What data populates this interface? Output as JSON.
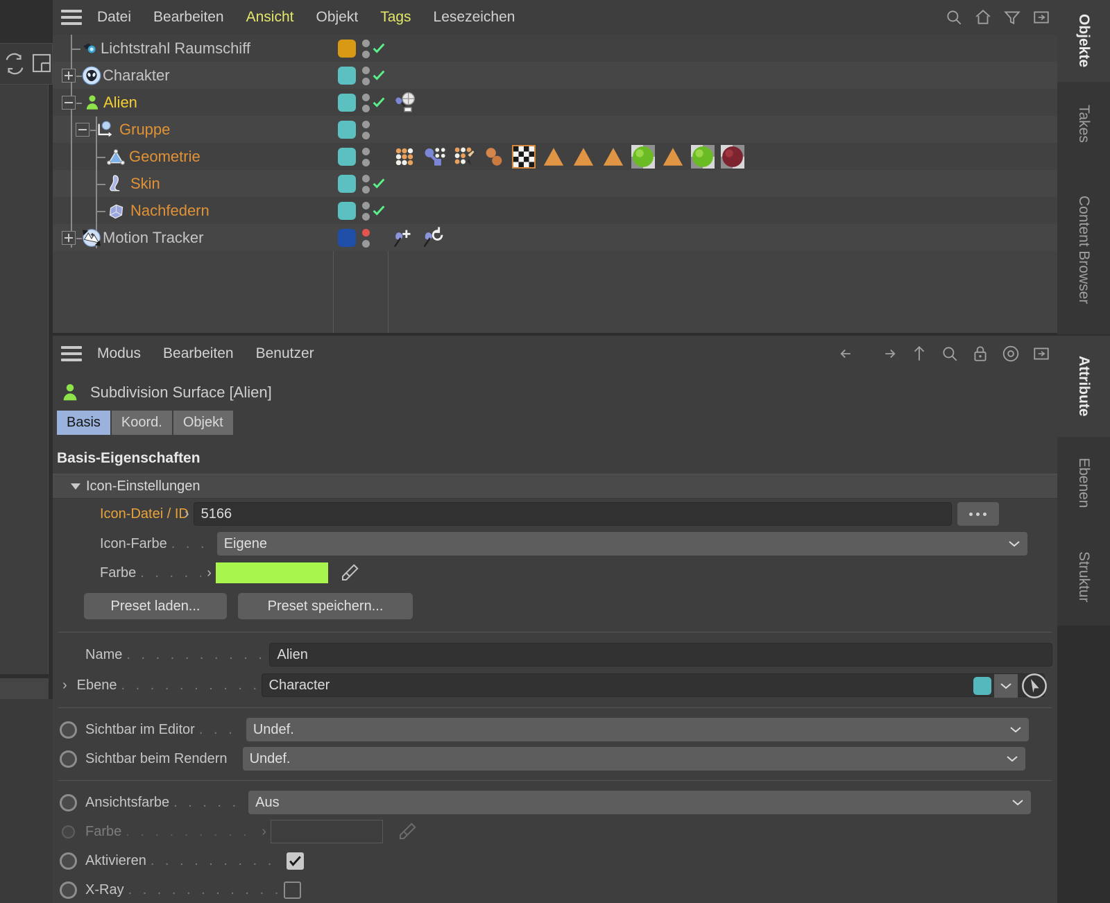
{
  "object_manager": {
    "menu": [
      {
        "label": "Datei",
        "highlight": false
      },
      {
        "label": "Bearbeiten",
        "highlight": false
      },
      {
        "label": "Ansicht",
        "highlight": true
      },
      {
        "label": "Objekt",
        "highlight": false
      },
      {
        "label": "Tags",
        "highlight": true
      },
      {
        "label": "Lesezeichen",
        "highlight": false
      }
    ],
    "toolbar_icons": [
      "search-icon",
      "home-icon",
      "filter-icon",
      "expand-panel-icon"
    ],
    "rows": [
      {
        "label": "Lichtstrahl Raumschiff",
        "color": "grey",
        "swatch": "#d89a15",
        "check": true,
        "dot_red": false,
        "indent": 1,
        "icon": "light-icon",
        "expander": "none",
        "tags": []
      },
      {
        "label": "Charakter",
        "color": "grey",
        "swatch": "#5cbfc0",
        "check": true,
        "dot_red": false,
        "indent": 0,
        "icon": "alien-head-icon",
        "expander": "plus",
        "tags": []
      },
      {
        "label": "Alien",
        "color": "yellow",
        "swatch": "#5cbfc0",
        "check": true,
        "dot_red": false,
        "indent": 0,
        "icon": "character-icon",
        "expander": "minus",
        "tags": [
          "joint-constraint-tag"
        ]
      },
      {
        "label": "Gruppe",
        "color": "orange",
        "swatch": "#5cbfc0",
        "check": false,
        "dot_red": false,
        "indent": 1,
        "icon": "null-object-icon",
        "expander": "minus",
        "tags": []
      },
      {
        "label": "Geometrie",
        "color": "orange",
        "swatch": "#5cbfc0",
        "check": false,
        "dot_red": false,
        "indent": 2,
        "icon": "polygon-icon",
        "expander": "none",
        "tags": [
          "point-cluster-tag",
          "weight-tag",
          "texture-brush-tag",
          "sphere-pair-tag",
          "checker-texture-tag",
          "cone-tag",
          "cone-tag",
          "cone-tag",
          "green-sphere-tag",
          "cone-tag",
          "green-sphere-tag",
          "red-sphere-tag"
        ]
      },
      {
        "label": "Skin",
        "color": "orange",
        "swatch": "#5cbfc0",
        "check": true,
        "dot_red": false,
        "indent": 2,
        "icon": "skin-icon",
        "expander": "none",
        "tags": []
      },
      {
        "label": "Nachfedern",
        "color": "orange",
        "swatch": "#5cbfc0",
        "check": true,
        "dot_red": false,
        "indent": 2,
        "icon": "jiggle-icon",
        "expander": "none",
        "tags": []
      },
      {
        "label": "Motion Tracker",
        "color": "grey",
        "swatch": "#1f4fa8",
        "check": false,
        "dot_red": true,
        "indent": 0,
        "icon": "motion-tracker-icon",
        "expander": "plus",
        "tags": [
          "pin-add-tag",
          "pin-rotate-tag"
        ]
      }
    ]
  },
  "attribute_manager": {
    "menu": [
      {
        "label": "Modus"
      },
      {
        "label": "Bearbeiten"
      },
      {
        "label": "Benutzer"
      }
    ],
    "toolbar_icons": [
      "back-arrow-icon",
      "forward-arrow-icon",
      "up-arrow-icon",
      "search-icon",
      "lock-icon",
      "record-icon",
      "expand-panel-icon"
    ],
    "title": "Subdivision Surface [Alien]",
    "tabs": [
      {
        "label": "Basis",
        "active": true
      },
      {
        "label": "Koord.",
        "active": false
      },
      {
        "label": "Objekt",
        "active": false
      }
    ],
    "section_title": "Basis-Eigenschaften",
    "icon_group": {
      "header": "Icon-Einstellungen",
      "icon_file_label": "Icon-Datei / ID",
      "icon_file_value": "5166",
      "icon_file_button": "...",
      "icon_color_label": "Icon-Farbe",
      "icon_color_value": "Eigene",
      "color_label": "Farbe",
      "color_value": "#a8f54d",
      "preset_load": "Preset laden...",
      "preset_save": "Preset speichern..."
    },
    "fields": {
      "name_label": "Name",
      "name_value": "Alien",
      "ebene_label": "Ebene",
      "ebene_value": "Character",
      "ebene_swatch": "#54b8bc",
      "editor_label": "Sichtbar im Editor",
      "editor_value": "Undef.",
      "render_label": "Sichtbar beim Rendern",
      "render_value": "Undef.",
      "viewcolor_label": "Ansichtsfarbe",
      "viewcolor_value": "Aus",
      "viewcolor_farbe_label": "Farbe",
      "viewcolor_farbe_value": "",
      "enable_label": "Aktivieren",
      "enable_checked": true,
      "xray_label": "X-Ray",
      "xray_checked": false
    }
  },
  "side_tabs": {
    "top": [
      {
        "label": "Objekte",
        "active": true
      },
      {
        "label": "Takes",
        "active": false
      },
      {
        "label": "Content Browser",
        "active": false
      }
    ],
    "bottom": [
      {
        "label": "Attribute",
        "active": true
      },
      {
        "label": "Ebenen",
        "active": false
      },
      {
        "label": "Struktur",
        "active": false
      }
    ]
  }
}
